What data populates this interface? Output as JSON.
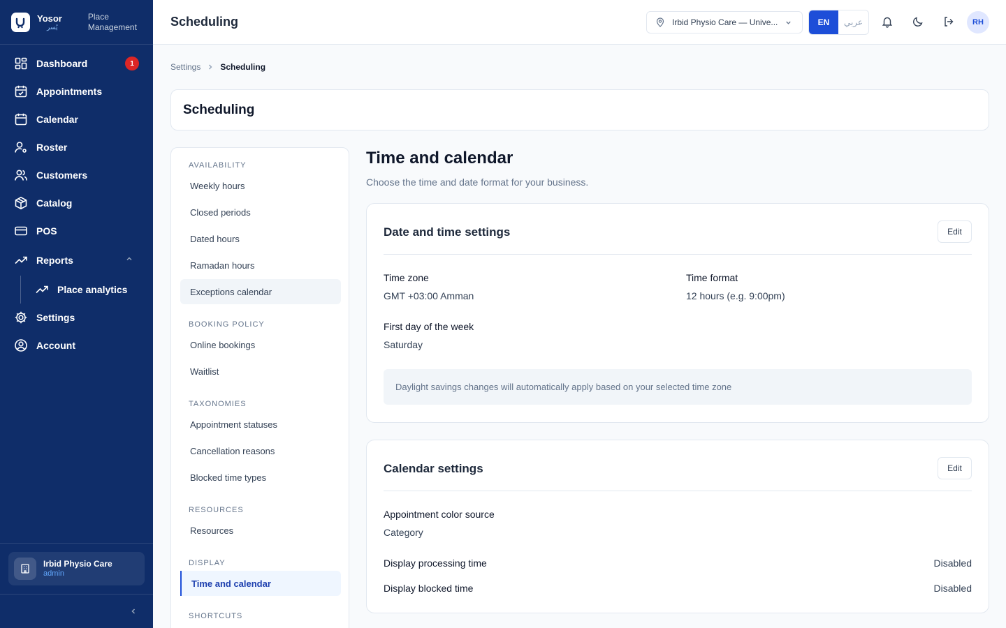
{
  "brand": {
    "name": "Yosor",
    "name_ar": "يُسر",
    "subtitle": "Place Management"
  },
  "sidebar": {
    "items": [
      {
        "label": "Dashboard",
        "badge": "1"
      },
      {
        "label": "Appointments"
      },
      {
        "label": "Calendar"
      },
      {
        "label": "Roster"
      },
      {
        "label": "Customers"
      },
      {
        "label": "Catalog"
      },
      {
        "label": "POS"
      },
      {
        "label": "Reports"
      },
      {
        "label": "Place analytics"
      },
      {
        "label": "Settings"
      },
      {
        "label": "Account"
      }
    ],
    "place": {
      "name": "Irbid Physio Care",
      "role": "admin"
    }
  },
  "header": {
    "title": "Scheduling",
    "place_select": "Irbid Physio Care — Unive...",
    "lang_en": "EN",
    "lang_ar": "عربي",
    "avatar": "RH"
  },
  "breadcrumb": {
    "parent": "Settings",
    "current": "Scheduling"
  },
  "page_title": "Scheduling",
  "subnav": {
    "availability": "AVAILABILITY",
    "weekly_hours": "Weekly hours",
    "closed_periods": "Closed periods",
    "dated_hours": "Dated hours",
    "ramadan_hours": "Ramadan hours",
    "exceptions_calendar": "Exceptions calendar",
    "booking_policy": "BOOKING POLICY",
    "online_bookings": "Online bookings",
    "waitlist": "Waitlist",
    "taxonomies": "TAXONOMIES",
    "appointment_statuses": "Appointment statuses",
    "cancellation_reasons": "Cancellation reasons",
    "blocked_time_types": "Blocked time types",
    "resources_section": "RESOURCES",
    "resources": "Resources",
    "display": "DISPLAY",
    "time_and_calendar": "Time and calendar",
    "shortcuts": "SHORTCUTS"
  },
  "content": {
    "title": "Time and calendar",
    "description": "Choose the time and date format for your business.",
    "date_time_card": {
      "title": "Date and time settings",
      "edit": "Edit",
      "time_zone_label": "Time zone",
      "time_zone_value": "GMT +03:00 Amman",
      "time_format_label": "Time format",
      "time_format_value": "12 hours (e.g. 9:00pm)",
      "first_day_label": "First day of the week",
      "first_day_value": "Saturday",
      "note": "Daylight savings changes will automatically apply based on your selected time zone"
    },
    "calendar_card": {
      "title": "Calendar settings",
      "edit": "Edit",
      "color_source_label": "Appointment color source",
      "color_source_value": "Category",
      "processing_label": "Display processing time",
      "processing_value": "Disabled",
      "blocked_label": "Display blocked time",
      "blocked_value": "Disabled"
    }
  },
  "colors": {
    "sidebar_bg": "#0f2d69",
    "accent": "#1d4ed8",
    "badge": "#dc2626"
  }
}
